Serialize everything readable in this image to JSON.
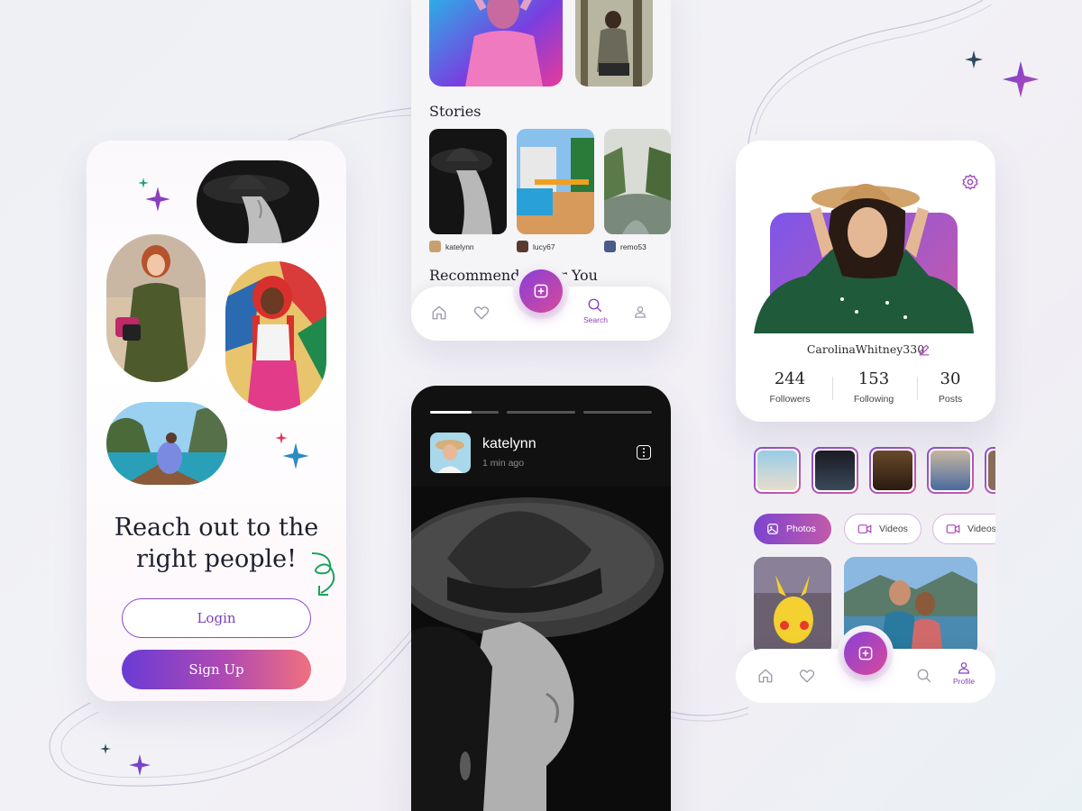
{
  "colors": {
    "accent_purple": "#7b44cf",
    "accent_pink": "#e46a8c",
    "dark_text": "#1e1f2e"
  },
  "welcome": {
    "headline_line1": "Reach out to the",
    "headline_line2": "right people!",
    "login_label": "Login",
    "signup_label": "Sign Up"
  },
  "explore": {
    "stories_title": "Stories",
    "recommended_title": "Recommended For You",
    "stories": [
      {
        "username": "katelynn"
      },
      {
        "username": "lucy67"
      },
      {
        "username": "remo53"
      }
    ],
    "nav": {
      "active_label": "Search",
      "items": [
        "home-icon",
        "heart-icon",
        "plus-icon",
        "search-icon",
        "user-icon"
      ]
    }
  },
  "viewer": {
    "username": "katelynn",
    "time": "1 min ago",
    "progress": [
      1,
      0,
      0
    ],
    "progress_first_fraction": 0.6
  },
  "profile": {
    "username": "CarolinaWhitney330",
    "stats": [
      {
        "value": "244",
        "label": "Followers"
      },
      {
        "value": "153",
        "label": "Following"
      },
      {
        "value": "30",
        "label": "Posts"
      }
    ],
    "filters": [
      "Photos",
      "Videos",
      "Videos"
    ],
    "nav": {
      "active_label": "Profile"
    }
  }
}
